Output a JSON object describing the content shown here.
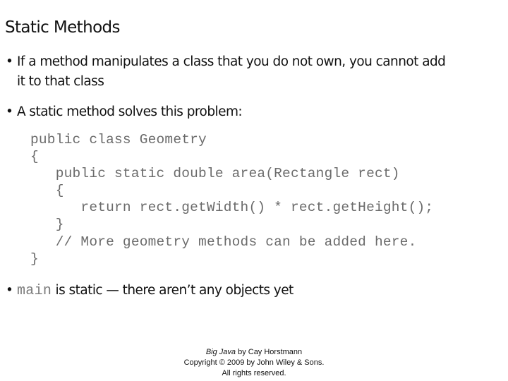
{
  "slide": {
    "title": "Static Methods",
    "bullets": [
      {
        "marker": "•",
        "line1": "If a method manipulates a class that you do not own, you cannot add",
        "line2": "it to that class"
      },
      {
        "marker": "•",
        "line1": "A static method solves this problem:"
      },
      {
        "marker": "•",
        "code": "main",
        "text": " is static — there aren’t any objects yet"
      }
    ],
    "code_lines": [
      "public class Geometry",
      "{",
      "   public static double area(Rectangle rect)",
      "   {",
      "      return rect.getWidth() * rect.getHeight();",
      "   }",
      "   // More geometry methods can be added here.",
      "}"
    ]
  },
  "footer": {
    "book_title": "Big Java",
    "byline": " by Cay Horstmann",
    "copyright": "Copyright © 2009 by John Wiley & Sons.",
    "rights": "All rights reserved."
  }
}
